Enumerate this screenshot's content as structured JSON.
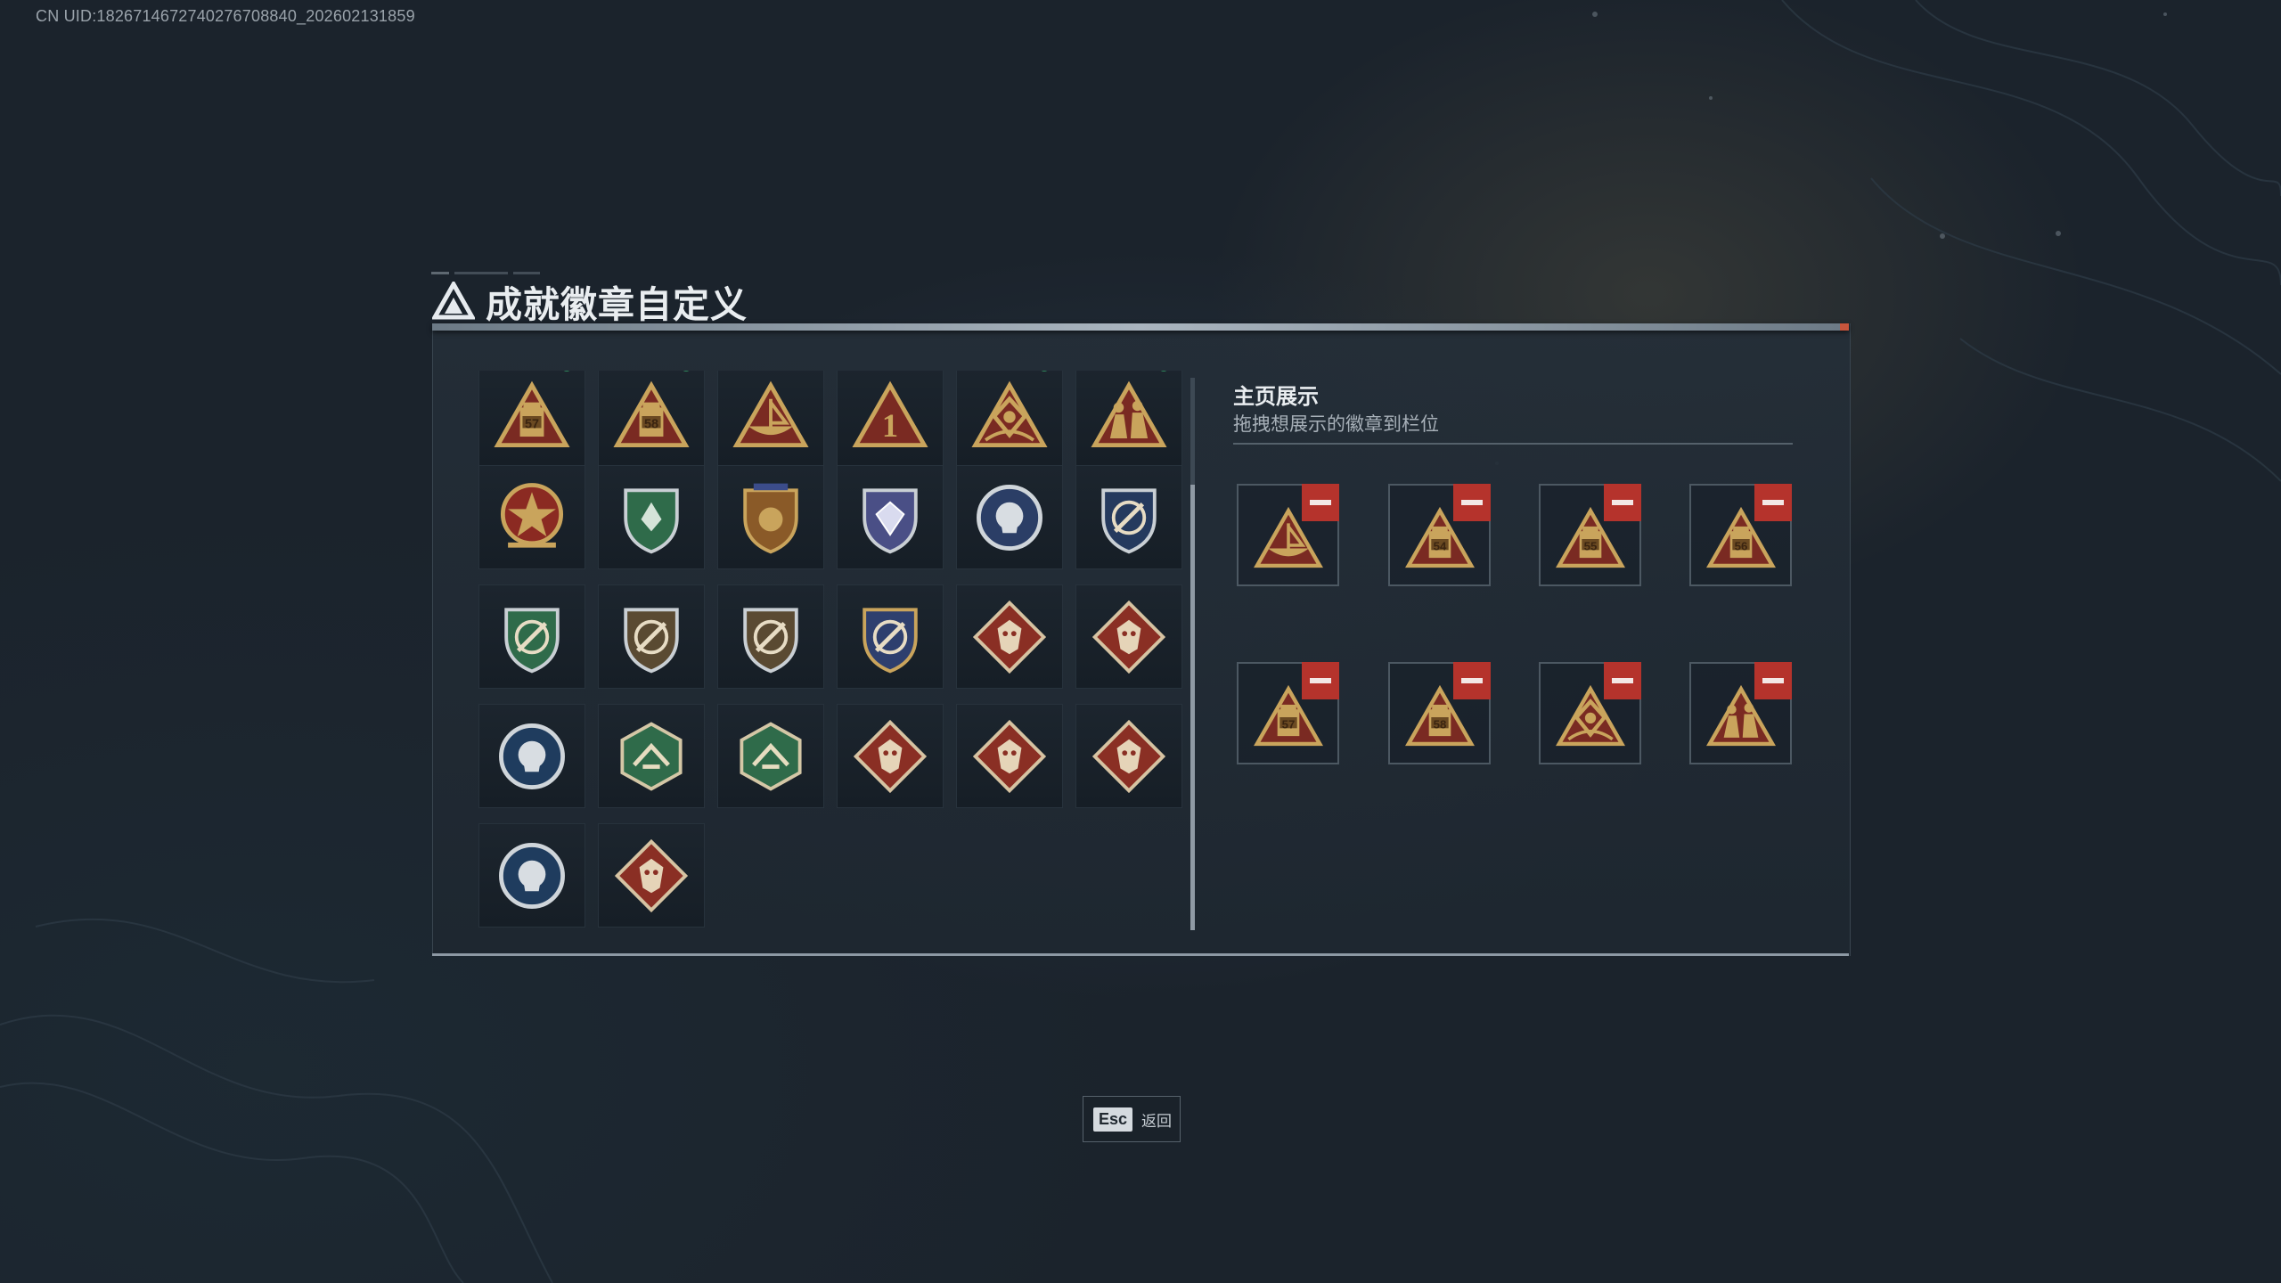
{
  "uid_text": "CN UID:1826714672740276708840_202602131859",
  "title": "成就徽章自定义",
  "showcase": {
    "title": "主页展示",
    "subtitle": "拖拽想展示的徽章到栏位"
  },
  "badges": [
    {
      "kind": "tri-tower-57",
      "new": true
    },
    {
      "kind": "tri-tower-58",
      "new": true
    },
    {
      "kind": "tri-boat",
      "new": false
    },
    {
      "kind": "tri-one",
      "new": false
    },
    {
      "kind": "tri-crest",
      "new": true
    },
    {
      "kind": "tri-soldiers",
      "new": true
    },
    {
      "kind": "star-medal-red",
      "new": false
    },
    {
      "kind": "shield-green-emblem",
      "new": false
    },
    {
      "kind": "shield-gold-stars",
      "new": false
    },
    {
      "kind": "shield-purple-gem",
      "new": false
    },
    {
      "kind": "round-skull-blue",
      "new": false
    },
    {
      "kind": "shield-navy-crosshair",
      "new": false
    },
    {
      "kind": "shield-green-crosshair",
      "new": false
    },
    {
      "kind": "shield-bronze-crosshair",
      "new": false
    },
    {
      "kind": "shield-bronze-crosshair",
      "new": false
    },
    {
      "kind": "shield-gold-crosshair",
      "new": false
    },
    {
      "kind": "diamond-wolf-red",
      "new": false
    },
    {
      "kind": "diamond-wolf-red",
      "new": false
    },
    {
      "kind": "round-eagle-blue",
      "new": false
    },
    {
      "kind": "hex-wings-green",
      "new": false
    },
    {
      "kind": "hex-gun-green",
      "new": false
    },
    {
      "kind": "diamond-dragon-red",
      "new": false
    },
    {
      "kind": "diamond-dragon-red",
      "new": false
    },
    {
      "kind": "diamond-runner-red",
      "new": false
    },
    {
      "kind": "round-wolf-blue",
      "new": false
    },
    {
      "kind": "diamond-fist-red",
      "new": false
    }
  ],
  "slots": [
    {
      "kind": "tri-boat",
      "number": ""
    },
    {
      "kind": "tri-tower",
      "number": "54"
    },
    {
      "kind": "tri-tower",
      "number": "55"
    },
    {
      "kind": "tri-tower",
      "number": "56"
    },
    {
      "kind": "tri-tower",
      "number": "57"
    },
    {
      "kind": "tri-tower",
      "number": "58"
    },
    {
      "kind": "tri-crest",
      "number": ""
    },
    {
      "kind": "tri-soldiers",
      "number": ""
    }
  ],
  "footer": {
    "key": "Esc",
    "label": "返回"
  },
  "colors": {
    "gold": "#c9a45c",
    "triangle_red": "#7a2a22",
    "remove_red": "#b5332c",
    "panel_bg": "#242e38"
  }
}
